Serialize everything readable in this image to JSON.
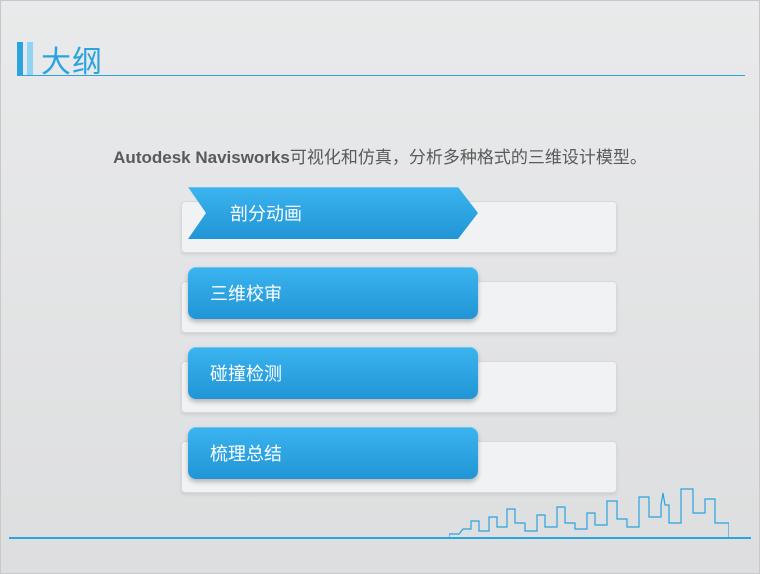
{
  "title": "大纲",
  "subtitle": {
    "bold": "Autodesk Navisworks",
    "rest": "可视化和仿真，分析多种格式的三维设计模型。"
  },
  "items": [
    {
      "label": "剖分动画",
      "style": "arrow"
    },
    {
      "label": "三维校审",
      "style": "rounded"
    },
    {
      "label": "碰撞检测",
      "style": "rounded"
    },
    {
      "label": "梳理总结",
      "style": "rounded"
    }
  ],
  "colors": {
    "accent": "#2aa3df",
    "accent_light": "#8fd4f2",
    "button_top": "#3bb4ef",
    "button_bottom": "#2195d6",
    "bg_top": "#e9eaeb",
    "bg_bottom": "#dddedf",
    "card_bg": "#f1f2f3"
  }
}
